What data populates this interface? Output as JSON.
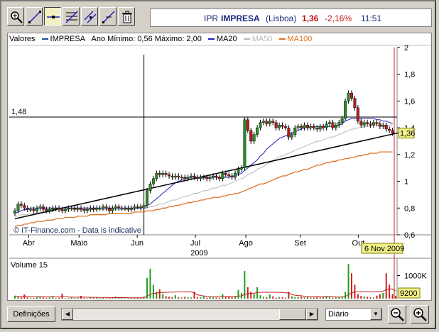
{
  "toolbar": {
    "tools": [
      {
        "name": "zoom-tool",
        "icon": "magnifier-icon"
      },
      {
        "name": "trendline-tool",
        "icon": "diagonal-line-icon"
      },
      {
        "name": "horizontal-line-tool",
        "icon": "horizontal-line-icon"
      },
      {
        "name": "fibonacci-tool",
        "icon": "fibonacci-icon"
      },
      {
        "name": "channel-tool",
        "icon": "channel-icon"
      },
      {
        "name": "parallel-lines-tool",
        "icon": "parallel-lines-icon"
      },
      {
        "name": "delete-tool",
        "icon": "trash-icon"
      }
    ]
  },
  "quote": {
    "ticker": "IPR",
    "name": "IMPRESA",
    "exchange": "(Lisboa)",
    "price": "1,36",
    "change": "-2,16%",
    "time": "11:51"
  },
  "legend": {
    "label": "Valores",
    "series": "IMPRESA",
    "range_text": "Ano Mínimo: 0,56 Máximo: 2,00",
    "ma20": "MA20",
    "ma50": "MA50",
    "ma100": "MA100"
  },
  "colors": {
    "price_line": "#000000",
    "up_candle": "#2d8a2d",
    "down_candle": "#b02020",
    "ma20": "#1f1fbf",
    "ma50": "#b8b8b8",
    "ma100": "#e07020",
    "volume_bar": "#d02020",
    "volume_bar_up": "#20a020"
  },
  "chart_data": {
    "type": "candlestick",
    "ylim": [
      0.6,
      2.0
    ],
    "yticks": [
      "2",
      "1,8",
      "1,6",
      "1,4",
      "1,2",
      "1",
      "0,8",
      "0,6"
    ],
    "months": [
      "Abr",
      "Maio",
      "Jun",
      "Jul",
      "Ago",
      "Set",
      "Out"
    ],
    "year": "2009",
    "date_label": "6 Nov 2009",
    "crosshair_value": "1,48",
    "last_price_label": "1,36",
    "watermark": "© IT-Finance.com - Data is indicative",
    "close": [
      0.78,
      0.83,
      0.82,
      0.8,
      0.79,
      0.79,
      0.78,
      0.8,
      0.81,
      0.79,
      0.78,
      0.79,
      0.8,
      0.8,
      0.79,
      0.78,
      0.79,
      0.8,
      0.8,
      0.79,
      0.8,
      0.79,
      0.78,
      0.79,
      0.8,
      0.79,
      0.8,
      0.8,
      0.81,
      0.8,
      0.78,
      0.8,
      0.81,
      0.8,
      0.8,
      0.8,
      0.79,
      0.8,
      0.81,
      0.81,
      0.8,
      0.82,
      0.93,
      0.98,
      1.02,
      1.06,
      1.05,
      1.06,
      1.05,
      1.04,
      1.03,
      1.04,
      1.03,
      1.03,
      1.02,
      1.03,
      1.04,
      1.03,
      1.02,
      1.03,
      1.03,
      1.02,
      1.03,
      1.04,
      1.03,
      1.02,
      1.06,
      1.05,
      1.04,
      1.03,
      1.06,
      1.09,
      1.1,
      1.46,
      1.38,
      1.3,
      1.35,
      1.4,
      1.44,
      1.45,
      1.43,
      1.45,
      1.44,
      1.4,
      1.42,
      1.41,
      1.4,
      1.33,
      1.35,
      1.4,
      1.41,
      1.4,
      1.42,
      1.4,
      1.41,
      1.4,
      1.39,
      1.41,
      1.4,
      1.43,
      1.44,
      1.4,
      1.42,
      1.44,
      1.47,
      1.6,
      1.66,
      1.62,
      1.55,
      1.45,
      1.42,
      1.44,
      1.43,
      1.42,
      1.44,
      1.43,
      1.41,
      1.42,
      1.39,
      1.38,
      1.36
    ],
    "ma20": [
      0.76,
      0.77,
      0.78,
      0.79,
      0.79,
      0.8,
      0.8,
      0.8,
      0.8,
      0.8,
      0.8,
      0.8,
      0.8,
      0.8,
      0.8,
      0.8,
      0.8,
      0.8,
      0.8,
      0.8,
      0.8,
      0.8,
      0.8,
      0.8,
      0.8,
      0.8,
      0.8,
      0.8,
      0.8,
      0.8,
      0.8,
      0.8,
      0.8,
      0.8,
      0.8,
      0.8,
      0.8,
      0.8,
      0.8,
      0.8,
      0.8,
      0.81,
      0.82,
      0.83,
      0.85,
      0.87,
      0.89,
      0.91,
      0.93,
      0.95,
      0.97,
      0.99,
      1.0,
      1.01,
      1.02,
      1.03,
      1.03,
      1.03,
      1.03,
      1.03,
      1.03,
      1.03,
      1.03,
      1.03,
      1.03,
      1.03,
      1.03,
      1.03,
      1.03,
      1.04,
      1.04,
      1.05,
      1.06,
      1.08,
      1.1,
      1.12,
      1.14,
      1.16,
      1.19,
      1.21,
      1.24,
      1.26,
      1.28,
      1.3,
      1.32,
      1.33,
      1.34,
      1.35,
      1.36,
      1.37,
      1.38,
      1.39,
      1.4,
      1.4,
      1.4,
      1.41,
      1.41,
      1.41,
      1.41,
      1.41,
      1.41,
      1.41,
      1.41,
      1.42,
      1.43,
      1.45,
      1.46,
      1.47,
      1.47,
      1.47,
      1.47,
      1.47,
      1.47,
      1.47,
      1.47,
      1.46,
      1.46,
      1.45,
      1.45,
      1.44,
      1.43
    ],
    "ma50": [
      0.74,
      0.74,
      0.75,
      0.75,
      0.75,
      0.76,
      0.76,
      0.76,
      0.77,
      0.77,
      0.77,
      0.77,
      0.78,
      0.78,
      0.78,
      0.78,
      0.78,
      0.78,
      0.78,
      0.79,
      0.79,
      0.79,
      0.79,
      0.79,
      0.79,
      0.79,
      0.79,
      0.79,
      0.79,
      0.79,
      0.79,
      0.79,
      0.79,
      0.79,
      0.79,
      0.79,
      0.79,
      0.79,
      0.79,
      0.8,
      0.8,
      0.8,
      0.8,
      0.81,
      0.81,
      0.82,
      0.83,
      0.83,
      0.84,
      0.85,
      0.86,
      0.86,
      0.87,
      0.88,
      0.89,
      0.89,
      0.9,
      0.91,
      0.91,
      0.92,
      0.93,
      0.93,
      0.94,
      0.95,
      0.95,
      0.96,
      0.97,
      0.97,
      0.98,
      0.99,
      1.0,
      1.01,
      1.02,
      1.03,
      1.05,
      1.06,
      1.07,
      1.09,
      1.1,
      1.11,
      1.13,
      1.14,
      1.15,
      1.17,
      1.18,
      1.19,
      1.2,
      1.21,
      1.22,
      1.23,
      1.24,
      1.25,
      1.26,
      1.27,
      1.28,
      1.29,
      1.3,
      1.3,
      1.31,
      1.32,
      1.33,
      1.33,
      1.34,
      1.35,
      1.36,
      1.37,
      1.38,
      1.39,
      1.39,
      1.4,
      1.4,
      1.41,
      1.41,
      1.41,
      1.42,
      1.42,
      1.42,
      1.42,
      1.42,
      1.42,
      1.42
    ],
    "ma100": [
      0.66,
      0.67,
      0.67,
      0.68,
      0.68,
      0.69,
      0.69,
      0.7,
      0.7,
      0.7,
      0.71,
      0.71,
      0.71,
      0.72,
      0.72,
      0.72,
      0.73,
      0.73,
      0.73,
      0.73,
      0.74,
      0.74,
      0.74,
      0.74,
      0.75,
      0.75,
      0.75,
      0.75,
      0.75,
      0.75,
      0.76,
      0.76,
      0.76,
      0.76,
      0.76,
      0.76,
      0.76,
      0.76,
      0.77,
      0.77,
      0.77,
      0.77,
      0.78,
      0.78,
      0.78,
      0.79,
      0.79,
      0.8,
      0.8,
      0.81,
      0.81,
      0.82,
      0.82,
      0.83,
      0.83,
      0.84,
      0.84,
      0.85,
      0.85,
      0.86,
      0.86,
      0.87,
      0.87,
      0.88,
      0.88,
      0.88,
      0.89,
      0.89,
      0.9,
      0.9,
      0.91,
      0.91,
      0.92,
      0.93,
      0.94,
      0.95,
      0.96,
      0.97,
      0.98,
      0.98,
      0.99,
      1.0,
      1.01,
      1.02,
      1.03,
      1.04,
      1.04,
      1.05,
      1.06,
      1.07,
      1.07,
      1.08,
      1.09,
      1.09,
      1.1,
      1.11,
      1.12,
      1.12,
      1.13,
      1.14,
      1.14,
      1.15,
      1.15,
      1.16,
      1.16,
      1.17,
      1.17,
      1.18,
      1.18,
      1.19,
      1.19,
      1.2,
      1.2,
      1.21,
      1.21,
      1.21,
      1.22,
      1.22,
      1.22,
      1.22,
      1.22
    ],
    "volume": {
      "title": "Volume 15",
      "yticks": [
        "1000K"
      ],
      "last_label": "9200",
      "values": [
        120,
        80,
        60,
        180,
        60,
        40,
        30,
        90,
        100,
        60,
        40,
        60,
        110,
        30,
        40,
        220,
        20,
        30,
        60,
        30,
        40,
        120,
        30,
        20,
        50,
        30,
        60,
        30,
        40,
        20,
        30,
        60,
        90,
        40,
        30,
        20,
        40,
        30,
        50,
        50,
        30,
        90,
        900,
        1300,
        600,
        300,
        400,
        200,
        100,
        80,
        60,
        150,
        60,
        50,
        80,
        60,
        50,
        300,
        70,
        60,
        100,
        40,
        80,
        60,
        50,
        40,
        200,
        80,
        100,
        60,
        120,
        380,
        250,
        1200,
        500,
        300,
        200,
        500,
        150,
        80,
        60,
        180,
        100,
        40,
        70,
        60,
        40,
        300,
        100,
        60,
        80,
        90,
        60,
        70,
        60,
        50,
        80,
        60,
        70,
        120,
        100,
        40,
        60,
        80,
        100,
        300,
        1500,
        1100,
        600,
        200,
        120,
        100,
        80,
        60,
        50,
        130,
        200,
        250,
        1100,
        600,
        200,
        120
      ]
    }
  },
  "bottom": {
    "settings_label": "Definições",
    "period_value": "Diário"
  }
}
